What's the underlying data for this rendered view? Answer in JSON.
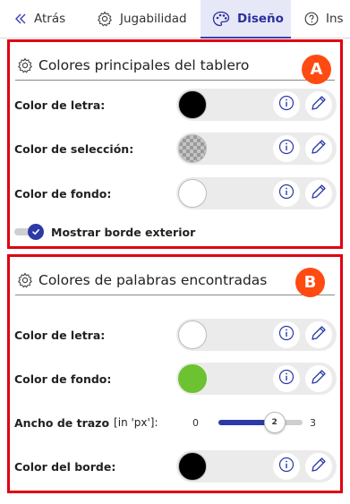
{
  "tabs": [
    {
      "label": "Atrás",
      "icon": "chevron-double-left-icon"
    },
    {
      "label": "Jugabilidad",
      "icon": "gear-icon"
    },
    {
      "label": "Diseño",
      "icon": "palette-icon",
      "active": true
    },
    {
      "label": "Ins",
      "icon": "question-circle-icon"
    }
  ],
  "panel_a": {
    "marker": "A",
    "title": "Colores principales del tablero",
    "rows": [
      {
        "label": "Color de letra:",
        "swatch_color": "#000000"
      },
      {
        "label": "Color de selección:",
        "swatch_color": "transparent"
      },
      {
        "label": "Color de fondo:",
        "swatch_color": "#ffffff"
      }
    ],
    "toggle": {
      "label": "Mostrar borde exterior",
      "checked": true
    }
  },
  "panel_b": {
    "marker": "B",
    "title": "Colores de palabras encontradas",
    "rows": [
      {
        "label": "Color de letra:",
        "swatch_color": "#ffffff"
      },
      {
        "label": "Color de fondo:",
        "swatch_color": "#6cc230"
      }
    ],
    "slider": {
      "label": "Ancho de trazo",
      "unit": "[in 'px']:",
      "min": "0",
      "max": "3",
      "value": "2"
    },
    "border_row": {
      "label": "Color del borde:",
      "swatch_color": "#000000"
    }
  },
  "colors": {
    "accent": "#2c3aa8",
    "frame": "#e00012",
    "marker": "#ff4a12",
    "active_tab_bg": "#e6e8f8"
  }
}
